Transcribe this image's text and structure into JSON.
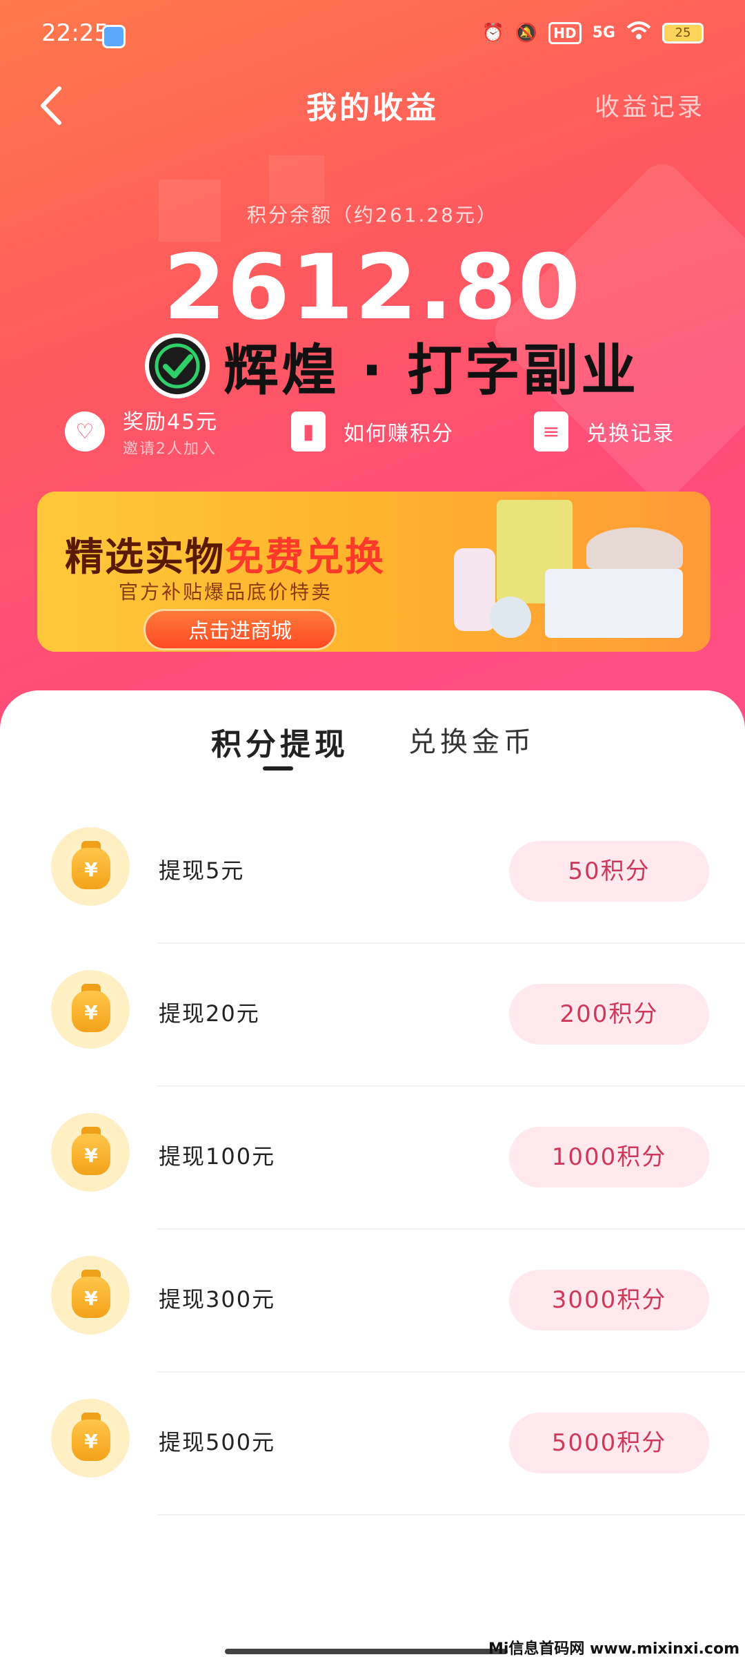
{
  "status_bar": {
    "time": "22:25",
    "network": "5G",
    "hd_badge": "HD",
    "battery": "25"
  },
  "nav": {
    "title": "我的收益",
    "right_link": "收益记录"
  },
  "balance": {
    "label": "积分余额（约261.28元）",
    "value": "2612.80"
  },
  "brand": {
    "text": "辉煌 · 打字副业"
  },
  "quick_links": [
    {
      "main": "奖励45元",
      "sub": "邀请2人加入",
      "icon": "heart-icon"
    },
    {
      "main": "如何赚积分",
      "sub": "",
      "icon": "book-icon"
    },
    {
      "main": "兑换记录",
      "sub": "",
      "icon": "document-icon"
    }
  ],
  "banner": {
    "title_part1": "精选实物",
    "title_part2": "免费兑换",
    "subtitle": "官方补贴爆品底价特卖",
    "button": "点击进商城"
  },
  "tabs": [
    {
      "label": "积分提现",
      "active": true
    },
    {
      "label": "兑换金币",
      "active": false
    }
  ],
  "withdraw_options": [
    {
      "label": "提现5元",
      "cost": "50积分"
    },
    {
      "label": "提现20元",
      "cost": "200积分"
    },
    {
      "label": "提现100元",
      "cost": "1000积分"
    },
    {
      "label": "提现300元",
      "cost": "3000积分"
    },
    {
      "label": "提现500元",
      "cost": "5000积分"
    }
  ],
  "coin_symbol": "¥",
  "watermark": "Mi信息首码网 www.mixinxi.com"
}
